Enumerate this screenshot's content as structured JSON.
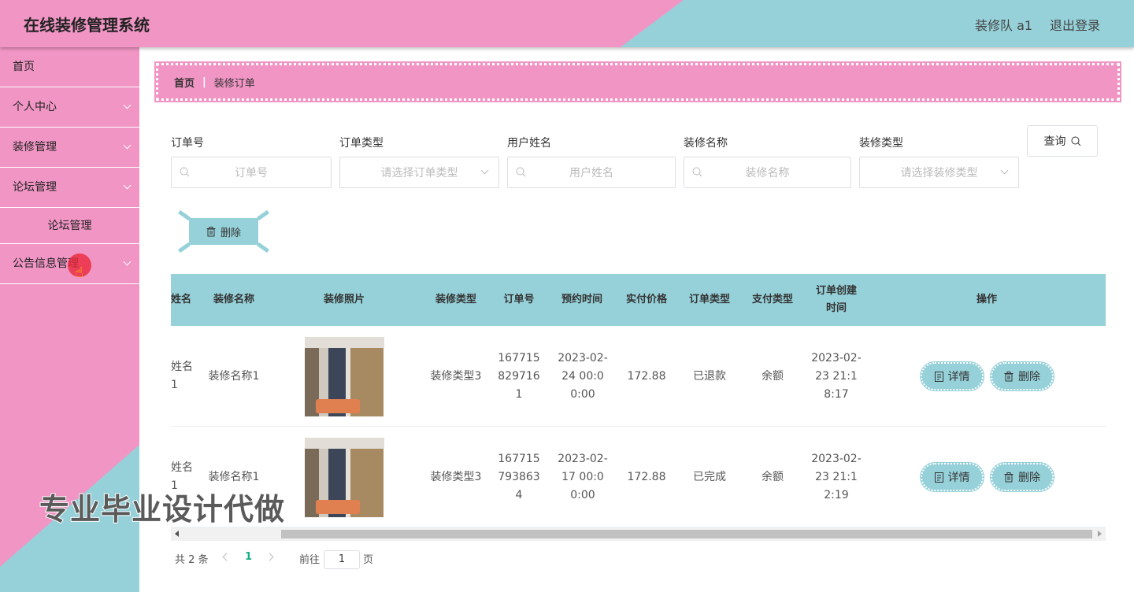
{
  "header": {
    "title": "在线装修管理系统",
    "user": "装修队 a1",
    "logout": "退出登录"
  },
  "sidebar": {
    "items": [
      {
        "label": "首页"
      },
      {
        "label": "个人中心"
      },
      {
        "label": "装修管理"
      },
      {
        "label": "论坛管理"
      },
      {
        "label": "论坛管理"
      },
      {
        "label": "公告信息管理"
      }
    ]
  },
  "breadcrumb": {
    "home": "首页",
    "current": "装修订单"
  },
  "search": {
    "order_no_label": "订单号",
    "order_no_placeholder": "订单号",
    "order_type_label": "订单类型",
    "order_type_placeholder": "请选择订单类型",
    "user_name_label": "用户姓名",
    "user_name_placeholder": "用户姓名",
    "deco_name_label": "装修名称",
    "deco_name_placeholder": "装修名称",
    "deco_type_label": "装修类型",
    "deco_type_placeholder": "请选择装修类型",
    "button": "查询"
  },
  "toolbar": {
    "delete": "删除"
  },
  "table": {
    "headers": {
      "name": "姓名",
      "deco_name": "装修名称",
      "photo": "装修照片",
      "deco_type": "装修类型",
      "order_no": "订单号",
      "appoint_time": "预约时间",
      "price": "实付价格",
      "order_type": "订单类型",
      "pay_type": "支付类型",
      "created": "订单创建时间",
      "actions": "操作"
    },
    "rows": [
      {
        "name": "姓名1",
        "deco_name": "装修名称1",
        "deco_type": "装修类型3",
        "order_no": "1677158297161",
        "appoint_time": "2023-02-24 00:00:00",
        "price": "172.88",
        "order_type": "已退款",
        "pay_type": "余额",
        "created": "2023-02-23 21:18:17"
      },
      {
        "name": "姓名1",
        "deco_name": "装修名称1",
        "deco_type": "装修类型3",
        "order_no": "1677157938634",
        "appoint_time": "2023-02-17 00:00:00",
        "price": "172.88",
        "order_type": "已完成",
        "pay_type": "余额",
        "created": "2023-02-23 21:12:19"
      }
    ],
    "detail_label": "详情",
    "delete_label": "删除"
  },
  "pagination": {
    "total": "共 2 条",
    "current": "1",
    "goto": "前往",
    "page_input": "1",
    "page_unit": "页"
  },
  "watermark": "专业毕业设计代做"
}
